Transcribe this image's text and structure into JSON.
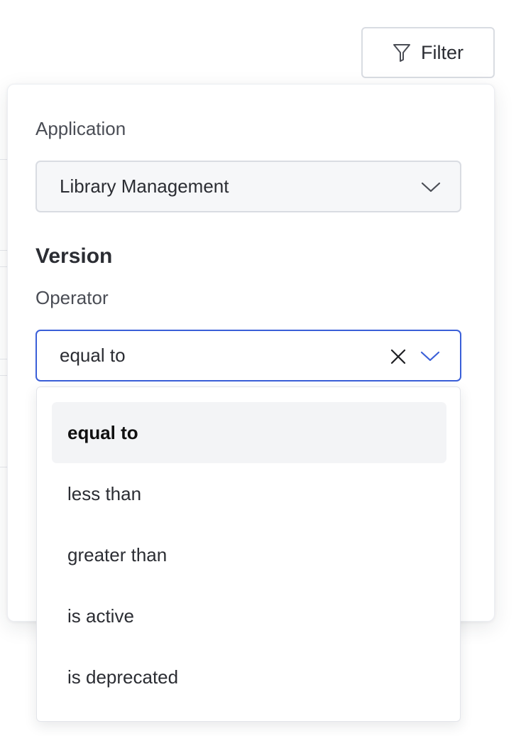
{
  "filter_button": {
    "label": "Filter",
    "icon": "funnel-icon"
  },
  "panel": {
    "application": {
      "label": "Application",
      "selected_value": "Library Management"
    },
    "version": {
      "heading": "Version",
      "operator_label": "Operator",
      "operator_value": "equal to"
    }
  },
  "operator_options": [
    {
      "label": "equal to",
      "selected": true
    },
    {
      "label": "less than",
      "selected": false
    },
    {
      "label": "greater than",
      "selected": false
    },
    {
      "label": "is active",
      "selected": false
    },
    {
      "label": "is deprecated",
      "selected": false
    }
  ],
  "colors": {
    "focus_border": "#3a5fd8",
    "selected_option_bg": "#f3f4f6"
  }
}
